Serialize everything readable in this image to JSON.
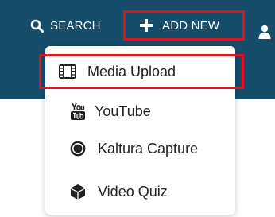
{
  "header": {
    "search_label": "SEARCH",
    "add_new_label": "ADD NEW",
    "search_icon": "search-icon",
    "add_icon": "plus-icon",
    "user_icon": "user-icon",
    "bar_color": "#154d6b",
    "highlight_color": "#e0141e"
  },
  "dropdown": {
    "items": [
      {
        "label": "Media Upload",
        "icon": "film-icon"
      },
      {
        "label": "YouTube",
        "icon": "youtube-icon"
      },
      {
        "label": "Kaltura Capture",
        "icon": "record-icon"
      },
      {
        "label": "Video Quiz",
        "icon": "cube-icon"
      }
    ]
  }
}
